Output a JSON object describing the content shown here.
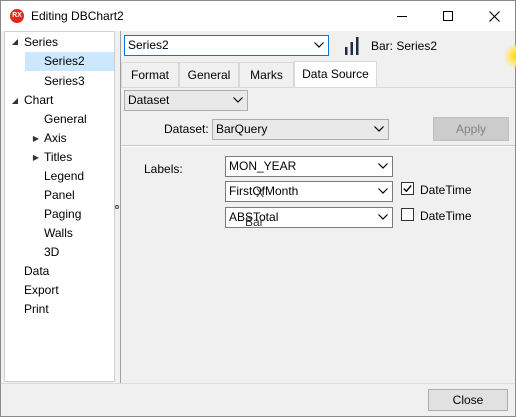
{
  "window": {
    "icon_text": "RX",
    "title": "Editing DBChart2"
  },
  "tree": {
    "items": [
      {
        "label": "Series",
        "level": 0,
        "expander": "collapse"
      },
      {
        "label": "Series2",
        "level": 1,
        "selected": true
      },
      {
        "label": "Series3",
        "level": 1
      },
      {
        "label": "Chart",
        "level": 0,
        "expander": "collapse"
      },
      {
        "label": "General",
        "level": 1
      },
      {
        "label": "Axis",
        "level": 1,
        "expander": "expand"
      },
      {
        "label": "Titles",
        "level": 1,
        "expander": "expand"
      },
      {
        "label": "Legend",
        "level": 1
      },
      {
        "label": "Panel",
        "level": 1
      },
      {
        "label": "Paging",
        "level": 1
      },
      {
        "label": "Walls",
        "level": 1
      },
      {
        "label": "3D",
        "level": 1
      },
      {
        "label": "Data",
        "level": 0
      },
      {
        "label": "Export",
        "level": 0
      },
      {
        "label": "Print",
        "level": 0
      }
    ]
  },
  "series_selector": {
    "value": "Series2",
    "series_label": "Bar: Series2",
    "icon": "bar-chart-icon"
  },
  "tabs": [
    {
      "label": "Format"
    },
    {
      "label": "General"
    },
    {
      "label": "Marks"
    },
    {
      "label": "Data Source",
      "active": true
    }
  ],
  "source_type": {
    "value": "Dataset"
  },
  "dataset": {
    "label": "Dataset:",
    "value": "BarQuery",
    "apply_label": "Apply"
  },
  "fields": {
    "labels_caption": "Labels:",
    "labels_value": "MON_YEAR",
    "x_value": "FirstOfMonth",
    "x_datetime_label": "DateTime",
    "x_datetime_checked": true,
    "y_value": "ABSTotal",
    "y_datetime_label": "DateTime",
    "y_datetime_checked": false,
    "x_overlay_text": "X",
    "y_overlay_text": "Bar"
  },
  "footer": {
    "close_label": "Close"
  },
  "colors": {
    "selection": "#cce8ff",
    "app_icon": "#e0281c",
    "focus_border": "#0078d7"
  }
}
